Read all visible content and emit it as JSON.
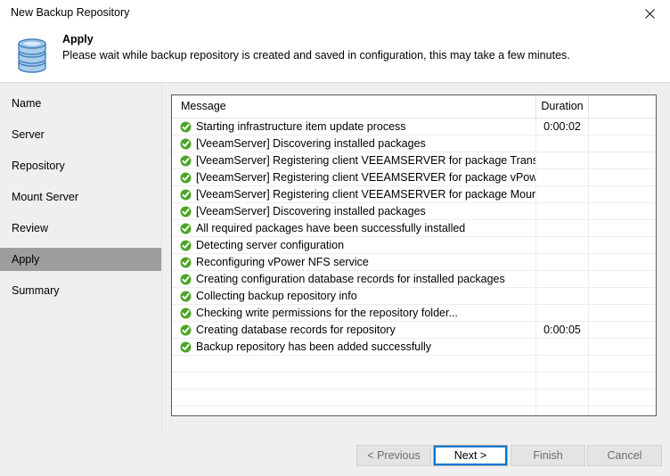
{
  "window": {
    "title": "New Backup Repository",
    "close_icon": "close-icon"
  },
  "header": {
    "icon": "database-repository-icon",
    "title": "Apply",
    "subtitle": "Please wait while backup repository is created and saved in configuration, this may take a few minutes."
  },
  "sidebar": {
    "items": [
      {
        "label": "Name",
        "selected": false
      },
      {
        "label": "Server",
        "selected": false
      },
      {
        "label": "Repository",
        "selected": false
      },
      {
        "label": "Mount Server",
        "selected": false
      },
      {
        "label": "Review",
        "selected": false
      },
      {
        "label": "Apply",
        "selected": true
      },
      {
        "label": "Summary",
        "selected": false
      }
    ]
  },
  "log": {
    "columns": [
      "Message",
      "Duration",
      ""
    ],
    "rows": [
      {
        "status": "success-check-icon",
        "message": "Starting infrastructure item update process",
        "duration": "0:00:02"
      },
      {
        "status": "success-check-icon",
        "message": "[VeeamServer] Discovering installed packages",
        "duration": ""
      },
      {
        "status": "success-check-icon",
        "message": "[VeeamServer] Registering client VEEAMSERVER for package Transport",
        "duration": ""
      },
      {
        "status": "success-check-icon",
        "message": "[VeeamServer] Registering client VEEAMSERVER for package vPower N...",
        "duration": ""
      },
      {
        "status": "success-check-icon",
        "message": "[VeeamServer] Registering client VEEAMSERVER for package Mount Se...",
        "duration": ""
      },
      {
        "status": "success-check-icon",
        "message": "[VeeamServer] Discovering installed packages",
        "duration": ""
      },
      {
        "status": "success-check-icon",
        "message": "All required packages have been successfully installed",
        "duration": ""
      },
      {
        "status": "success-check-icon",
        "message": "Detecting server configuration",
        "duration": ""
      },
      {
        "status": "success-check-icon",
        "message": "Reconfiguring vPower NFS service",
        "duration": ""
      },
      {
        "status": "success-check-icon",
        "message": "Creating configuration database records for installed packages",
        "duration": ""
      },
      {
        "status": "success-check-icon",
        "message": "Collecting backup repository info",
        "duration": ""
      },
      {
        "status": "success-check-icon",
        "message": "Checking write permissions for the repository folder...",
        "duration": ""
      },
      {
        "status": "success-check-icon",
        "message": "Creating database records for repository",
        "duration": "0:00:05"
      },
      {
        "status": "success-check-icon",
        "message": "Backup repository has been added successfully",
        "duration": ""
      },
      {
        "status": "",
        "message": "",
        "duration": ""
      },
      {
        "status": "",
        "message": "",
        "duration": ""
      },
      {
        "status": "",
        "message": "",
        "duration": ""
      },
      {
        "status": "",
        "message": "",
        "duration": ""
      }
    ]
  },
  "footer": {
    "buttons": [
      {
        "label": "< Previous",
        "enabled": false,
        "focused": false
      },
      {
        "label": "Next >",
        "enabled": true,
        "focused": true
      },
      {
        "label": "Finish",
        "enabled": false,
        "focused": false
      },
      {
        "label": "Cancel",
        "enabled": false,
        "focused": false
      }
    ]
  },
  "colors": {
    "success_green": "#4ca527",
    "focus_blue": "#0078d7",
    "selection_gray": "#9d9d9d",
    "panel_gray": "#efefef",
    "icon_blue": "#aacde8",
    "icon_blue_stroke": "#3f7fbf"
  }
}
